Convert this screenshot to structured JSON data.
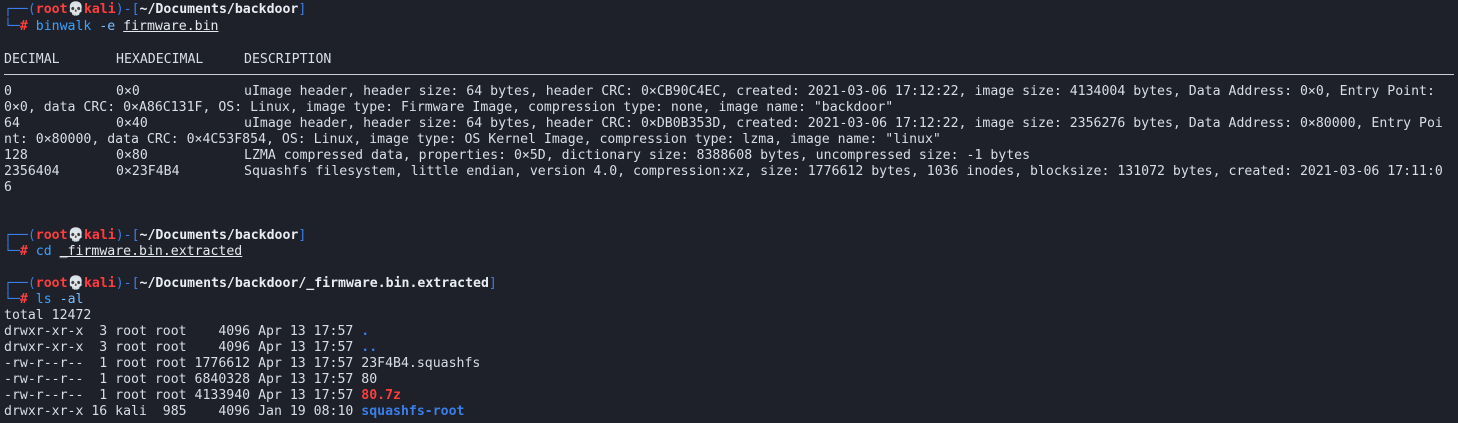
{
  "prompts": [
    {
      "top1": "┌──(",
      "user": "root",
      "skull": "💀",
      "host": "kali",
      "mid": ")-[",
      "path": "~/Documents/backdoor",
      "end": "]",
      "top2": "└─",
      "hash": "#",
      "cmd": "binwalk",
      "flag": "-e",
      "arg": "firmware.bin"
    },
    {
      "top1": "┌──(",
      "user": "root",
      "skull": "💀",
      "host": "kali",
      "mid": ")-[",
      "path": "~/Documents/backdoor",
      "end": "]",
      "top2": "└─",
      "hash": "#",
      "cmd": "cd",
      "flag": "",
      "arg": "_firmware.bin.extracted"
    },
    {
      "top1": "┌──(",
      "user": "root",
      "skull": "💀",
      "host": "kali",
      "mid": ")-[",
      "path": "~/Documents/backdoor/_firmware.bin.extracted",
      "end": "]",
      "top2": "└─",
      "hash": "#",
      "cmd": "ls",
      "flag": "-al",
      "arg": ""
    }
  ],
  "binwalk": {
    "headers": [
      "DECIMAL",
      "HEXADECIMAL",
      "DESCRIPTION"
    ],
    "rows": [
      {
        "dec": "0",
        "hex": "0×0",
        "desc": "uImage header, header size: 64 bytes, header CRC: 0×CB90C4EC, created: 2021-03-06 17:12:22, image size: 4134004 bytes, Data Address: 0×0, Entry Point:",
        "cont": "0×0, data CRC: 0×A86C131F, OS: Linux, image type: Firmware Image, compression type: none, image name: \"backdoor\""
      },
      {
        "dec": "64",
        "hex": "0×40",
        "desc": "uImage header, header size: 64 bytes, header CRC: 0×DB0B353D, created: 2021-03-06 17:12:22, image size: 2356276 bytes, Data Address: 0×80000, Entry Poi",
        "cont": "nt: 0×80000, data CRC: 0×4C53F854, OS: Linux, image type: OS Kernel Image, compression type: lzma, image name: \"linux\""
      },
      {
        "dec": "128",
        "hex": "0×80",
        "desc": "LZMA compressed data, properties: 0×5D, dictionary size: 8388608 bytes, uncompressed size: -1 bytes",
        "cont": ""
      },
      {
        "dec": "2356404",
        "hex": "0×23F4B4",
        "desc": "Squashfs filesystem, little endian, version 4.0, compression:xz, size: 1776612 bytes, 1036 inodes, blocksize: 131072 bytes, created: 2021-03-06 17:11:0",
        "cont": "6"
      }
    ]
  },
  "ls": {
    "total": "total 12472",
    "entries": [
      {
        "meta": "drwxr-xr-x  3 root root    4096 Apr 13 17:57 ",
        "name": ".",
        "kind": "dir"
      },
      {
        "meta": "drwxr-xr-x  3 root root    4096 Apr 13 17:57 ",
        "name": "..",
        "kind": "dir"
      },
      {
        "meta": "-rw-r--r--  1 root root 1776612 Apr 13 17:57 ",
        "name": "23F4B4.squashfs",
        "kind": "file"
      },
      {
        "meta": "-rw-r--r--  1 root root 6840328 Apr 13 17:57 ",
        "name": "80",
        "kind": "file"
      },
      {
        "meta": "-rw-r--r--  1 root root 4133940 Apr 13 17:57 ",
        "name": "80.7z",
        "kind": "archive"
      },
      {
        "meta": "drwxr-xr-x 16 kali  985    4096 Jan 19 08:10 ",
        "name": "squashfs-root",
        "kind": "dir"
      }
    ]
  },
  "colors": {
    "background": "#1e2129",
    "prompt_red": "#ff3d3d",
    "bracket_blue": "#3a7ee8",
    "command_blue": "#3ba3ff"
  }
}
